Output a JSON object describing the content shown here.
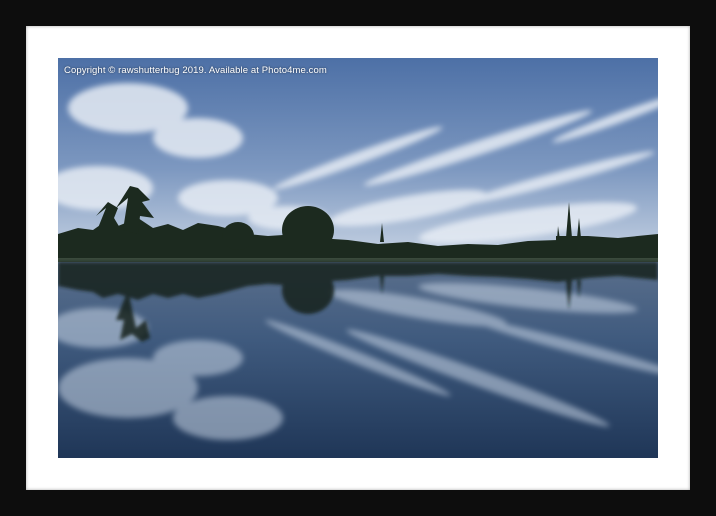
{
  "watermark": {
    "text": "Copyright © rawshutterbug 2019. Available at Photo4me.com"
  },
  "colors": {
    "frame": "#0d0d0d",
    "mount": "#ffffff",
    "sky_top": "#4a6fa8",
    "sky_horizon": "#c9d6e6",
    "water": "#2f4a6b"
  }
}
